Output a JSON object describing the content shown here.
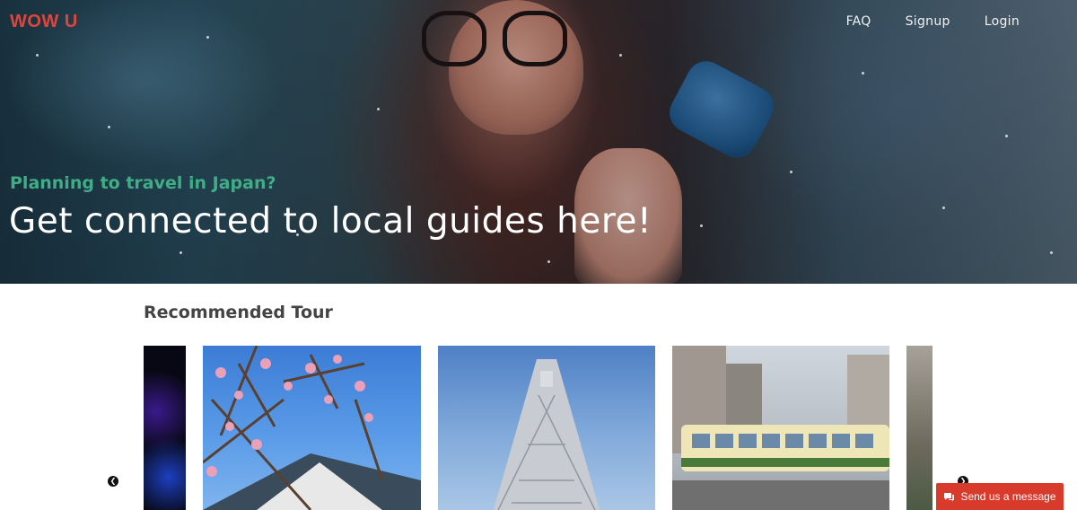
{
  "header": {
    "logo": "WOW U",
    "nav": [
      {
        "label": "FAQ"
      },
      {
        "label": "Signup"
      },
      {
        "label": "Login"
      }
    ]
  },
  "hero": {
    "subtitle": "Planning to travel in Japan?",
    "title": "Get connected to local guides here!"
  },
  "recommended": {
    "title": "Recommended Tour",
    "cards": [
      {
        "icon": "night-light-photo"
      },
      {
        "icon": "cherry-blossom-photo"
      },
      {
        "icon": "skytree-tower-photo"
      },
      {
        "icon": "tram-photo"
      },
      {
        "icon": "street-photo"
      }
    ]
  },
  "chat": {
    "label": "Send us a message"
  },
  "colors": {
    "brand": "#e0453c",
    "accent_green": "#3fae86",
    "chat_button": "#d83a2c"
  }
}
